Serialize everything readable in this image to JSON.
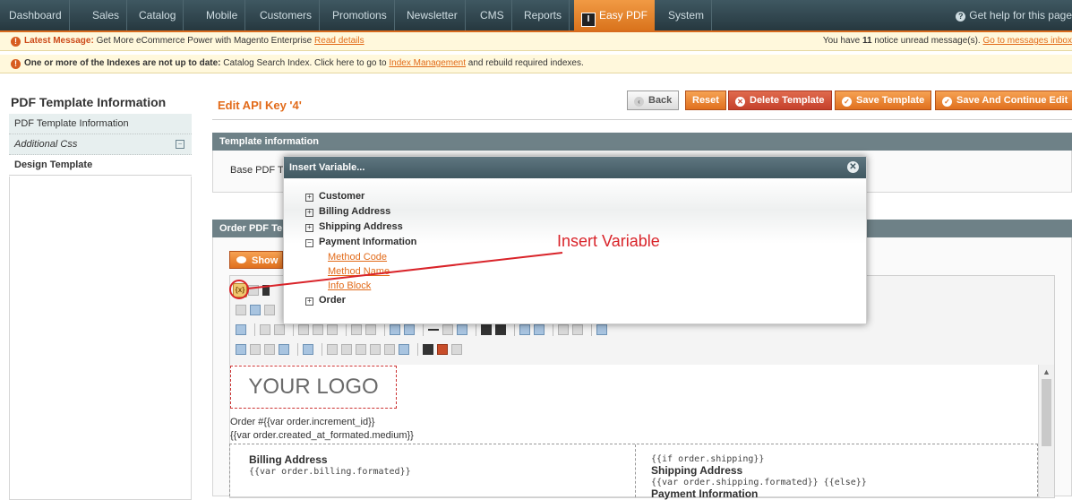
{
  "nav": {
    "items": [
      "Dashboard",
      "Sales",
      "Catalog",
      "Mobile",
      "Customers",
      "Promotions",
      "Newsletter",
      "CMS",
      "Reports",
      "Easy PDF",
      "System"
    ],
    "pdf_badge": "I",
    "help": "Get help for this page"
  },
  "notice1": {
    "label": "Latest Message:",
    "text": "Get More eCommerce Power with Magento Enterprise",
    "link": "Read details",
    "right_prefix": "You have",
    "right_count": "11",
    "right_suffix": "notice unread message(s).",
    "right_link": "Go to messages inbox"
  },
  "notice2": {
    "bold": "One or more of the Indexes are not up to date:",
    "text": "Catalog Search Index. Click here to go to",
    "link": "Index Management",
    "after": "and rebuild required indexes."
  },
  "sidebar": {
    "title": "PDF Template Information",
    "tabs": [
      "PDF Template Information",
      "Additional Css",
      "Design Template"
    ]
  },
  "page": {
    "title": "Edit API Key '4'",
    "buttons": {
      "back": "Back",
      "reset": "Reset",
      "delete": "Delete Template",
      "save": "Save Template",
      "save_continue": "Save And Continue Edit"
    }
  },
  "sections": {
    "template_info": "Template information",
    "base_label": "Base PDF T",
    "order_pdf": "Order PDF Te",
    "show_btn": "Show"
  },
  "modal": {
    "title": "Insert Variable...",
    "tree": {
      "customer": "Customer",
      "billing": "Billing Address",
      "shipping": "Shipping Address",
      "payment": "Payment Information",
      "payment_children": [
        "Method Code",
        "Method Name",
        "Info Block"
      ],
      "order": "Order"
    }
  },
  "annotation": "Insert Variable",
  "editor": {
    "logo": "YOUR LOGO",
    "order_line1": "Order #{{var order.increment_id}}",
    "order_line2": "{{var order.created_at_formated.medium}}",
    "billing_title": "Billing Address",
    "billing_var": "{{var order.billing.formated}}",
    "shipping_if": "{{if order.shipping}}",
    "shipping_title": "Shipping Address",
    "shipping_var": "{{var order.shipping.formated}} {{else}}",
    "payment_title": "Payment Information"
  },
  "colors": {
    "accent": "#e26b1a",
    "nav_bg": "#2d4249",
    "section_head": "#6e8187",
    "annotation": "#d9242a"
  }
}
